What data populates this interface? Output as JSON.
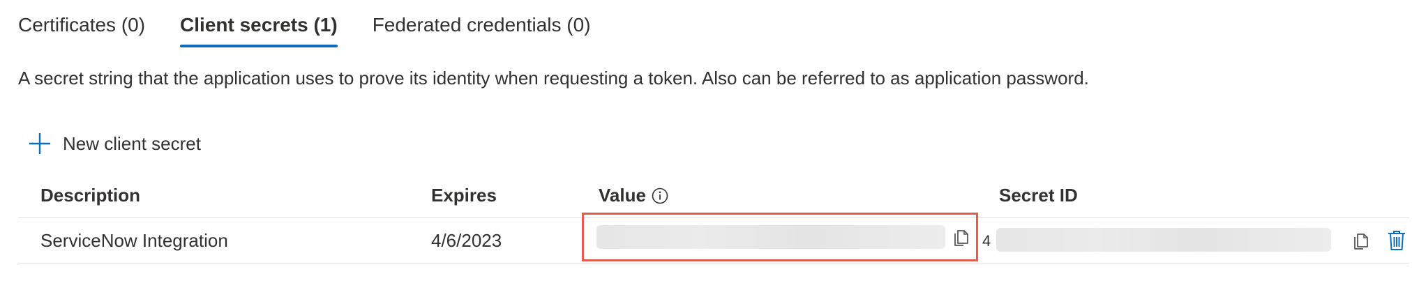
{
  "tabs": [
    {
      "label": "Certificates (0)",
      "active": false
    },
    {
      "label": "Client secrets (1)",
      "active": true
    },
    {
      "label": "Federated credentials (0)",
      "active": false
    }
  ],
  "description": "A secret string that the application uses to prove its identity when requesting a token. Also can be referred to as application password.",
  "toolbar": {
    "new_secret_label": "New client secret",
    "icon": "plus-icon"
  },
  "table": {
    "headers": {
      "description": "Description",
      "expires": "Expires",
      "value": "Value",
      "secret_id": "Secret ID"
    },
    "rows": [
      {
        "description": "ServiceNow Integration",
        "expires": "4/6/2023",
        "value": "",
        "secret_id_prefix": "4",
        "secret_id": ""
      }
    ]
  },
  "colors": {
    "accent": "#0f6cbd",
    "highlight_border": "#e35d4f",
    "text": "#323130",
    "divider": "#e1dfdd"
  }
}
